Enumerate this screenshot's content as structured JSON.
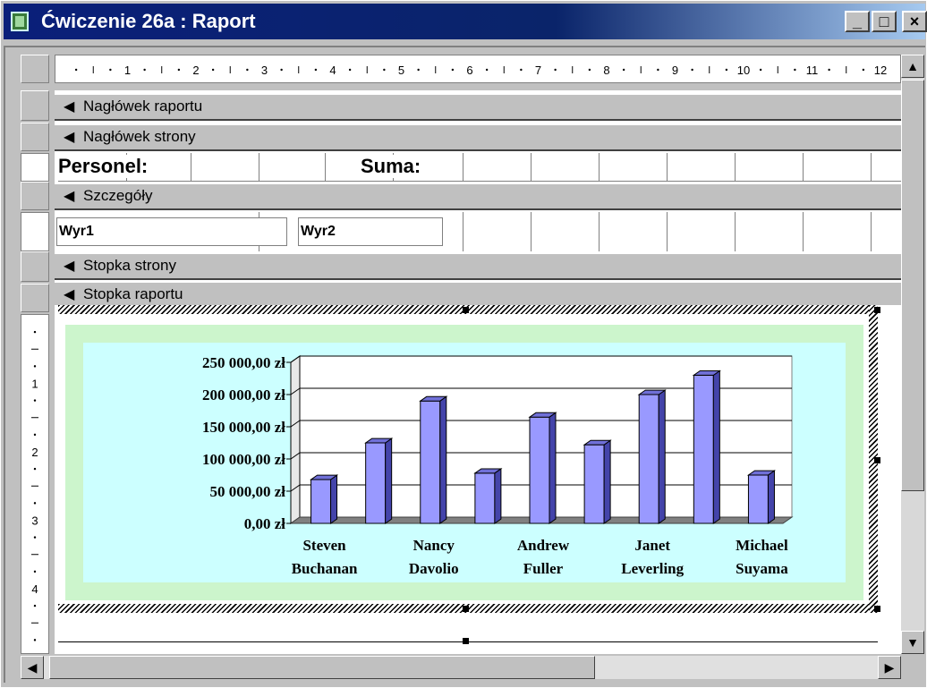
{
  "window": {
    "title": "Ćwiczenie 26a : Raport",
    "min_label": "_",
    "max_label": "□",
    "close_label": "×"
  },
  "ruler": {
    "labels": [
      "1",
      "2",
      "3",
      "4",
      "5",
      "6",
      "7",
      "8",
      "9",
      "10",
      "11",
      "12"
    ]
  },
  "vruler": {
    "labels": [
      "1",
      "2",
      "3",
      "4"
    ]
  },
  "bands": {
    "report_header": "Nagłówek raportu",
    "page_header": "Nagłówek strony",
    "detail": "Szczegóły",
    "page_footer": "Stopka strony",
    "report_footer": "Stopka raportu"
  },
  "page_header_section": {
    "personel": "Personel:",
    "suma": "Suma:"
  },
  "detail_section": {
    "field1": "Wyr1",
    "field2": "Wyr2"
  },
  "colors": {
    "bar": "#9999ff",
    "bar_side": "#4444aa",
    "bar_top": "#7070d8",
    "plot_bg": "#ffffff",
    "chart_bg": "#ccffff",
    "chart_border": "#ccf5cc"
  },
  "chart_data": {
    "type": "bar",
    "categories": [
      "Steven Buchanan",
      "",
      "Nancy Davolio",
      "",
      "Andrew Fuller",
      "",
      "Janet Leverling",
      "",
      "Michael Suyama"
    ],
    "category_labels": [
      [
        "Steven",
        "Buchanan"
      ],
      [
        "Nancy",
        "Davolio"
      ],
      [
        "Andrew",
        "Fuller"
      ],
      [
        "Janet",
        "Leverling"
      ],
      [
        "Michael",
        "Suyama"
      ]
    ],
    "values": [
      68000,
      125000,
      190000,
      78000,
      165000,
      122000,
      200000,
      230000,
      75000
    ],
    "ytick_labels": [
      "250 000,00 zł",
      "200 000,00 zł",
      "150 000,00 zł",
      "100 000,00 zł",
      "50 000,00 zł",
      "0,00 zł"
    ],
    "ylim": [
      0,
      250000
    ],
    "grid": true,
    "legend": "none",
    "style": "3d-column"
  },
  "scrollbars": {
    "up": "▲",
    "down": "▼",
    "left": "◀",
    "right": "▶"
  }
}
